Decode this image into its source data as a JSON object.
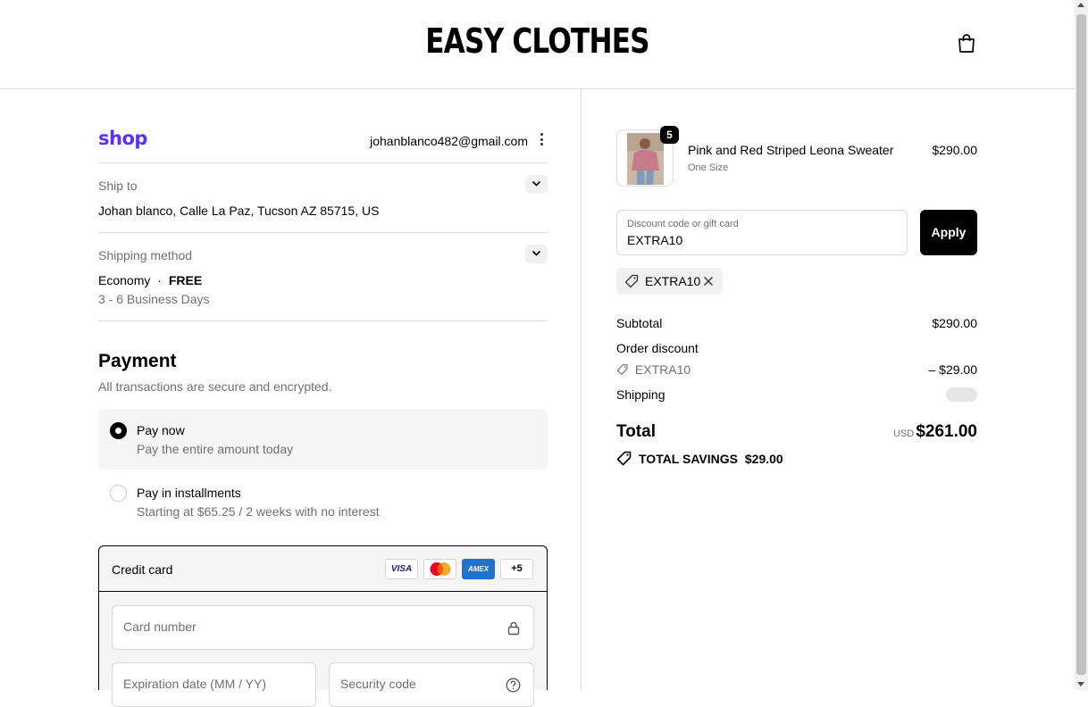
{
  "header": {
    "brand": "EASY CLOTHES",
    "cart_icon": "shopping-bag-icon"
  },
  "account": {
    "logo": "shop",
    "email": "johanblanco482@gmail.com",
    "menu_icon": "kebab-menu-icon"
  },
  "ship_to": {
    "label": "Ship to",
    "value": "Johan blanco, Calle La Paz, Tucson AZ 85715, US"
  },
  "shipping_method": {
    "label": "Shipping method",
    "name": "Economy",
    "separator": "·",
    "price": "FREE",
    "eta": "3 - 6 Business Days"
  },
  "payment": {
    "title": "Payment",
    "subtitle": "All transactions are secure and encrypted.",
    "options": [
      {
        "title": "Pay now",
        "desc": "Pay the entire amount today",
        "selected": true
      },
      {
        "title": "Pay in installments",
        "desc": "Starting at $65.25 / 2 weeks with no interest",
        "selected": false
      }
    ],
    "credit_card": {
      "label": "Credit card",
      "brands": [
        "VISA",
        "mastercard",
        "AMEX",
        "+5"
      ],
      "card_number_placeholder": "Card number",
      "expiry_placeholder": "Expiration date (MM / YY)",
      "security_placeholder": "Security code"
    }
  },
  "order": {
    "item": {
      "quantity": "5",
      "name": "Pink and Red Striped Leona Sweater",
      "variant": "One Size",
      "price": "$290.00"
    },
    "discount_field": {
      "label": "Discount code or gift card",
      "value": "EXTRA10"
    },
    "apply_label": "Apply",
    "applied_code": "EXTRA10",
    "subtotal_label": "Subtotal",
    "subtotal": "$290.00",
    "order_discount_label": "Order discount",
    "discount_code": "EXTRA10",
    "discount_amount": "– $29.00",
    "shipping_label": "Shipping",
    "total_label": "Total",
    "currency": "USD",
    "total": "$261.00",
    "savings_label": "TOTAL SAVINGS",
    "savings_amount": "$29.00"
  },
  "colors": {
    "shop_purple": "#5a31f4",
    "amex_blue": "#1f72cd",
    "visa_navy": "#1a1f71"
  }
}
